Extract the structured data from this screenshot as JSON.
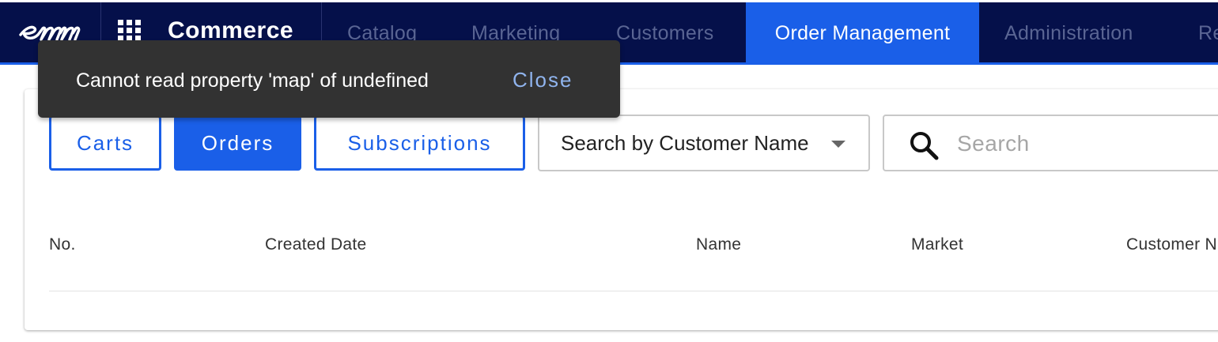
{
  "header": {
    "logo_icon": "emarsys-logo-icon",
    "apps_icon": "apps-grid-icon",
    "brand": "Commerce",
    "tabs": [
      {
        "label": "Catalog"
      },
      {
        "label": "Marketing"
      },
      {
        "label": "Customers"
      },
      {
        "label": "Order Management",
        "active": true
      },
      {
        "label": "Administration"
      },
      {
        "label": "Re"
      }
    ],
    "colors": {
      "background": "#05104a",
      "accent": "#1a5fe8",
      "inactive_tab": "#5a6593"
    }
  },
  "snackbar": {
    "message": "Cannot read property 'map' of undefined",
    "action": "Close",
    "background": "#323232",
    "action_color": "#90b4ee"
  },
  "order_types": {
    "carts": "Carts",
    "orders": "Orders",
    "subscriptions": "Subscriptions",
    "selected": "Orders"
  },
  "filter": {
    "select_value": "Search by Customer Name",
    "caret_icon": "caret-down-icon"
  },
  "search": {
    "icon": "search-icon",
    "placeholder": "Search",
    "value": ""
  },
  "table": {
    "columns": [
      "No.",
      "Created Date",
      "Name",
      "Market",
      "Customer N"
    ]
  }
}
